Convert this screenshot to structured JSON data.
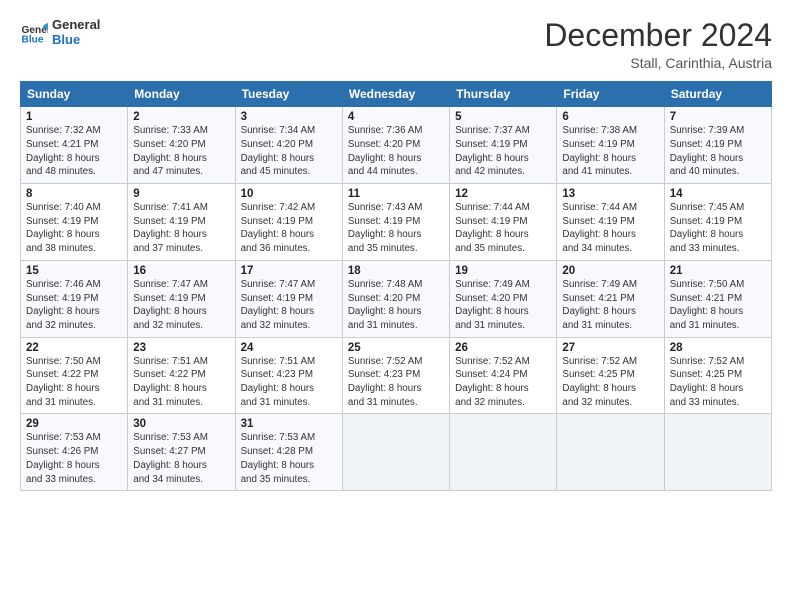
{
  "header": {
    "logo_line1": "General",
    "logo_line2": "Blue",
    "main_title": "December 2024",
    "subtitle": "Stall, Carinthia, Austria"
  },
  "days_of_week": [
    "Sunday",
    "Monday",
    "Tuesday",
    "Wednesday",
    "Thursday",
    "Friday",
    "Saturday"
  ],
  "weeks": [
    [
      {
        "day": "1",
        "sunrise": "7:32 AM",
        "sunset": "4:21 PM",
        "daylight": "8 hours and 48 minutes."
      },
      {
        "day": "2",
        "sunrise": "7:33 AM",
        "sunset": "4:20 PM",
        "daylight": "8 hours and 47 minutes."
      },
      {
        "day": "3",
        "sunrise": "7:34 AM",
        "sunset": "4:20 PM",
        "daylight": "8 hours and 45 minutes."
      },
      {
        "day": "4",
        "sunrise": "7:36 AM",
        "sunset": "4:20 PM",
        "daylight": "8 hours and 44 minutes."
      },
      {
        "day": "5",
        "sunrise": "7:37 AM",
        "sunset": "4:19 PM",
        "daylight": "8 hours and 42 minutes."
      },
      {
        "day": "6",
        "sunrise": "7:38 AM",
        "sunset": "4:19 PM",
        "daylight": "8 hours and 41 minutes."
      },
      {
        "day": "7",
        "sunrise": "7:39 AM",
        "sunset": "4:19 PM",
        "daylight": "8 hours and 40 minutes."
      }
    ],
    [
      {
        "day": "8",
        "sunrise": "7:40 AM",
        "sunset": "4:19 PM",
        "daylight": "8 hours and 38 minutes."
      },
      {
        "day": "9",
        "sunrise": "7:41 AM",
        "sunset": "4:19 PM",
        "daylight": "8 hours and 37 minutes."
      },
      {
        "day": "10",
        "sunrise": "7:42 AM",
        "sunset": "4:19 PM",
        "daylight": "8 hours and 36 minutes."
      },
      {
        "day": "11",
        "sunrise": "7:43 AM",
        "sunset": "4:19 PM",
        "daylight": "8 hours and 35 minutes."
      },
      {
        "day": "12",
        "sunrise": "7:44 AM",
        "sunset": "4:19 PM",
        "daylight": "8 hours and 35 minutes."
      },
      {
        "day": "13",
        "sunrise": "7:44 AM",
        "sunset": "4:19 PM",
        "daylight": "8 hours and 34 minutes."
      },
      {
        "day": "14",
        "sunrise": "7:45 AM",
        "sunset": "4:19 PM",
        "daylight": "8 hours and 33 minutes."
      }
    ],
    [
      {
        "day": "15",
        "sunrise": "7:46 AM",
        "sunset": "4:19 PM",
        "daylight": "8 hours and 32 minutes."
      },
      {
        "day": "16",
        "sunrise": "7:47 AM",
        "sunset": "4:19 PM",
        "daylight": "8 hours and 32 minutes."
      },
      {
        "day": "17",
        "sunrise": "7:47 AM",
        "sunset": "4:19 PM",
        "daylight": "8 hours and 32 minutes."
      },
      {
        "day": "18",
        "sunrise": "7:48 AM",
        "sunset": "4:20 PM",
        "daylight": "8 hours and 31 minutes."
      },
      {
        "day": "19",
        "sunrise": "7:49 AM",
        "sunset": "4:20 PM",
        "daylight": "8 hours and 31 minutes."
      },
      {
        "day": "20",
        "sunrise": "7:49 AM",
        "sunset": "4:21 PM",
        "daylight": "8 hours and 31 minutes."
      },
      {
        "day": "21",
        "sunrise": "7:50 AM",
        "sunset": "4:21 PM",
        "daylight": "8 hours and 31 minutes."
      }
    ],
    [
      {
        "day": "22",
        "sunrise": "7:50 AM",
        "sunset": "4:22 PM",
        "daylight": "8 hours and 31 minutes."
      },
      {
        "day": "23",
        "sunrise": "7:51 AM",
        "sunset": "4:22 PM",
        "daylight": "8 hours and 31 minutes."
      },
      {
        "day": "24",
        "sunrise": "7:51 AM",
        "sunset": "4:23 PM",
        "daylight": "8 hours and 31 minutes."
      },
      {
        "day": "25",
        "sunrise": "7:52 AM",
        "sunset": "4:23 PM",
        "daylight": "8 hours and 31 minutes."
      },
      {
        "day": "26",
        "sunrise": "7:52 AM",
        "sunset": "4:24 PM",
        "daylight": "8 hours and 32 minutes."
      },
      {
        "day": "27",
        "sunrise": "7:52 AM",
        "sunset": "4:25 PM",
        "daylight": "8 hours and 32 minutes."
      },
      {
        "day": "28",
        "sunrise": "7:52 AM",
        "sunset": "4:25 PM",
        "daylight": "8 hours and 33 minutes."
      }
    ],
    [
      {
        "day": "29",
        "sunrise": "7:53 AM",
        "sunset": "4:26 PM",
        "daylight": "8 hours and 33 minutes."
      },
      {
        "day": "30",
        "sunrise": "7:53 AM",
        "sunset": "4:27 PM",
        "daylight": "8 hours and 34 minutes."
      },
      {
        "day": "31",
        "sunrise": "7:53 AM",
        "sunset": "4:28 PM",
        "daylight": "8 hours and 35 minutes."
      },
      null,
      null,
      null,
      null
    ]
  ],
  "labels": {
    "sunrise": "Sunrise:",
    "sunset": "Sunset:",
    "daylight": "Daylight:"
  }
}
